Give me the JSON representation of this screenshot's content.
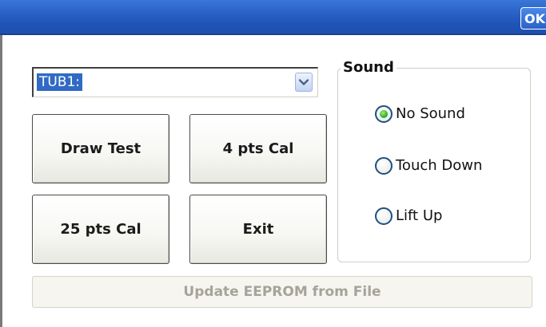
{
  "titlebar": {
    "ok_label": "OK"
  },
  "dropdown": {
    "selected": "TUB1:",
    "arrow_icon": "chevron-down-icon"
  },
  "buttons": {
    "draw_test": "Draw Test",
    "four_pts_cal": "4 pts Cal",
    "twentyfive_pts_cal": "25 pts Cal",
    "exit": "Exit"
  },
  "sound": {
    "legend": "Sound",
    "options": [
      {
        "label": "No Sound",
        "checked": true
      },
      {
        "label": "Touch Down",
        "checked": false
      },
      {
        "label": "Lift Up",
        "checked": false
      }
    ]
  },
  "update_button": {
    "label": "Update EEPROM from File",
    "enabled": false
  },
  "colors": {
    "titlebar": "#2a62c7",
    "selection": "#316ac5",
    "radio_checked": "#35b01f",
    "disabled_text": "#a6a39a"
  }
}
